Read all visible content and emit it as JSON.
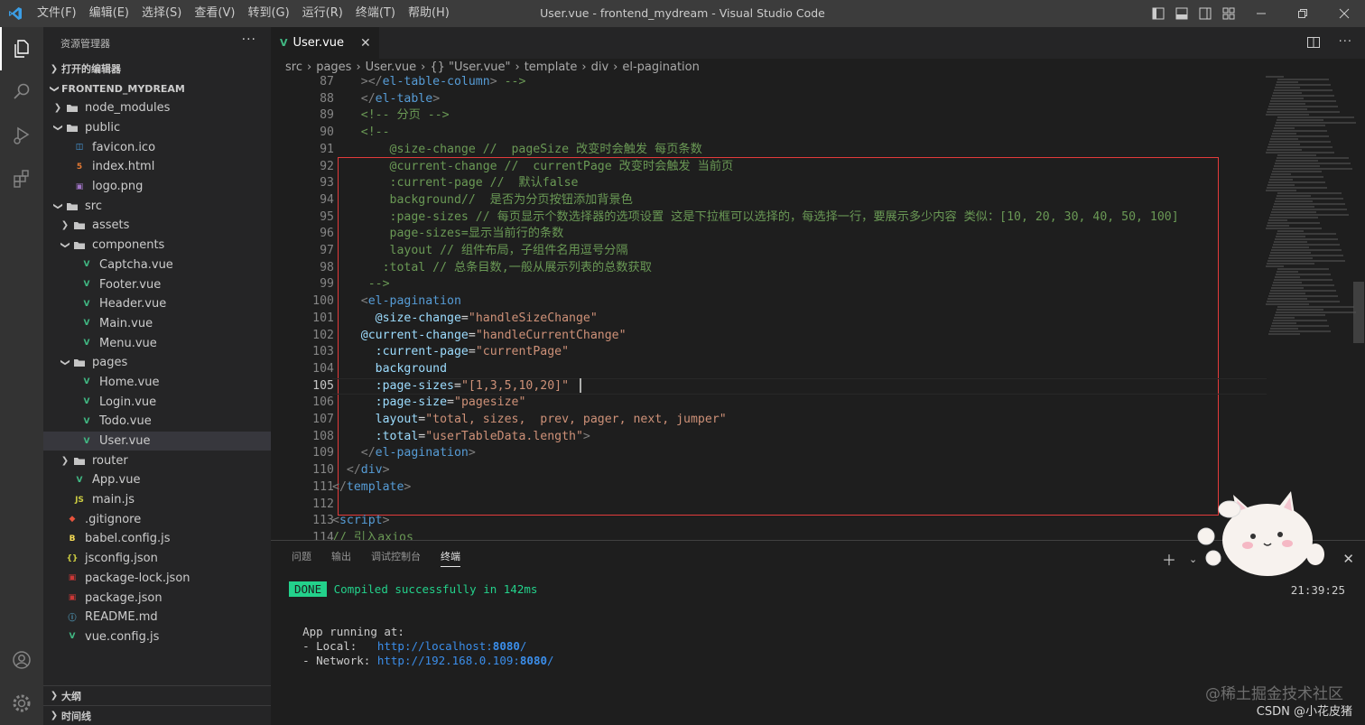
{
  "titlebar": {
    "menu": [
      "文件(F)",
      "编辑(E)",
      "选择(S)",
      "查看(V)",
      "转到(G)",
      "运行(R)",
      "终端(T)",
      "帮助(H)"
    ],
    "window_title": "User.vue - frontend_mydream - Visual Studio Code"
  },
  "activity_bar": {
    "items": [
      "explorer-icon",
      "search-icon",
      "run-debug-icon",
      "extensions-icon"
    ],
    "bottom": [
      "account-icon",
      "settings-gear-icon"
    ]
  },
  "sidebar": {
    "title": "资源管理器",
    "open_editors": "打开的编辑器",
    "project": "FRONTEND_MYDREAM",
    "tree": [
      {
        "label": "node_modules",
        "depth": 1,
        "type": "folder",
        "expanded": false
      },
      {
        "label": "public",
        "depth": 1,
        "type": "folder",
        "expanded": true
      },
      {
        "label": "favicon.ico",
        "depth": 2,
        "type": "ico"
      },
      {
        "label": "index.html",
        "depth": 2,
        "type": "html"
      },
      {
        "label": "logo.png",
        "depth": 2,
        "type": "png"
      },
      {
        "label": "src",
        "depth": 1,
        "type": "folder",
        "expanded": true
      },
      {
        "label": "assets",
        "depth": 2,
        "type": "folder",
        "expanded": false
      },
      {
        "label": "components",
        "depth": 2,
        "type": "folder",
        "expanded": true
      },
      {
        "label": "Captcha.vue",
        "depth": 3,
        "type": "vue"
      },
      {
        "label": "Footer.vue",
        "depth": 3,
        "type": "vue"
      },
      {
        "label": "Header.vue",
        "depth": 3,
        "type": "vue"
      },
      {
        "label": "Main.vue",
        "depth": 3,
        "type": "vue"
      },
      {
        "label": "Menu.vue",
        "depth": 3,
        "type": "vue"
      },
      {
        "label": "pages",
        "depth": 2,
        "type": "folder",
        "expanded": true
      },
      {
        "label": "Home.vue",
        "depth": 3,
        "type": "vue"
      },
      {
        "label": "Login.vue",
        "depth": 3,
        "type": "vue"
      },
      {
        "label": "Todo.vue",
        "depth": 3,
        "type": "vue"
      },
      {
        "label": "User.vue",
        "depth": 3,
        "type": "vue",
        "selected": true
      },
      {
        "label": "router",
        "depth": 2,
        "type": "folder",
        "expanded": false
      },
      {
        "label": "App.vue",
        "depth": 2,
        "type": "vue"
      },
      {
        "label": "main.js",
        "depth": 2,
        "type": "js"
      },
      {
        "label": ".gitignore",
        "depth": 1,
        "type": "git"
      },
      {
        "label": "babel.config.js",
        "depth": 1,
        "type": "babel"
      },
      {
        "label": "jsconfig.json",
        "depth": 1,
        "type": "jsconfig"
      },
      {
        "label": "package-lock.json",
        "depth": 1,
        "type": "npm"
      },
      {
        "label": "package.json",
        "depth": 1,
        "type": "npm"
      },
      {
        "label": "README.md",
        "depth": 1,
        "type": "md"
      },
      {
        "label": "vue.config.js",
        "depth": 1,
        "type": "vue"
      }
    ],
    "outline": "大纲",
    "timeline": "时间线"
  },
  "editor": {
    "tab_label": "User.vue",
    "breadcrumb": [
      "src",
      "pages",
      "User.vue",
      "{} \"User.vue\"",
      "template",
      "div",
      "el-pagination"
    ],
    "current_line": 105,
    "lines": [
      {
        "n": 87,
        "seg": [
          [
            "tx",
            "    "
          ],
          [
            "br",
            "></"
          ],
          [
            "tg",
            "el-table-column"
          ],
          [
            "br",
            "> "
          ],
          [
            "cm",
            "-->"
          ]
        ]
      },
      {
        "n": 88,
        "seg": [
          [
            "tx",
            "    "
          ],
          [
            "br",
            "</"
          ],
          [
            "tg",
            "el-table"
          ],
          [
            "br",
            ">"
          ]
        ]
      },
      {
        "n": 89,
        "seg": [
          [
            "tx",
            "    "
          ],
          [
            "cm",
            "<!-- 分页 -->"
          ]
        ]
      },
      {
        "n": 90,
        "seg": [
          [
            "tx",
            "    "
          ],
          [
            "cm",
            "<!--"
          ]
        ]
      },
      {
        "n": 91,
        "seg": [
          [
            "cm",
            "        @size-change //  pageSize 改变时会触发 每页条数"
          ]
        ]
      },
      {
        "n": 92,
        "seg": [
          [
            "cm",
            "        @current-change //  currentPage 改变时会触发 当前页"
          ]
        ]
      },
      {
        "n": 93,
        "seg": [
          [
            "cm",
            "        :current-page //  默认false"
          ]
        ]
      },
      {
        "n": 94,
        "seg": [
          [
            "cm",
            "        background//  是否为分页按钮添加背景色"
          ]
        ]
      },
      {
        "n": 95,
        "seg": [
          [
            "cm",
            "        :page-sizes // 每页显示个数选择器的选项设置 这是下拉框可以选择的，每选择一行，要展示多少内容 类似：[10, 20, 30, 40, 50, 100]"
          ]
        ]
      },
      {
        "n": 96,
        "seg": [
          [
            "cm",
            "        page-sizes=显示当前行的条数"
          ]
        ]
      },
      {
        "n": 97,
        "seg": [
          [
            "cm",
            "        layout // 组件布局，子组件名用逗号分隔"
          ]
        ]
      },
      {
        "n": 98,
        "seg": [
          [
            "cm",
            "       :total // 总条目数,一般从展示列表的总数获取"
          ]
        ]
      },
      {
        "n": 99,
        "seg": [
          [
            "cm",
            "     -->"
          ]
        ]
      },
      {
        "n": 100,
        "seg": [
          [
            "tx",
            "    "
          ],
          [
            "br",
            "<"
          ],
          [
            "tg",
            "el-pagination"
          ]
        ]
      },
      {
        "n": 101,
        "seg": [
          [
            "tx",
            "      "
          ],
          [
            "at",
            "@size-change"
          ],
          [
            "tx",
            "="
          ],
          [
            "st",
            "\"handleSizeChange\""
          ]
        ]
      },
      {
        "n": 102,
        "seg": [
          [
            "tx",
            "    "
          ],
          [
            "at",
            "@current-change"
          ],
          [
            "tx",
            "="
          ],
          [
            "st",
            "\"handleCurrentChange\""
          ]
        ]
      },
      {
        "n": 103,
        "seg": [
          [
            "tx",
            "      "
          ],
          [
            "at",
            ":current-page"
          ],
          [
            "tx",
            "="
          ],
          [
            "st",
            "\"currentPage\""
          ]
        ]
      },
      {
        "n": 104,
        "seg": [
          [
            "tx",
            "      "
          ],
          [
            "at",
            "background"
          ]
        ]
      },
      {
        "n": 105,
        "seg": [
          [
            "tx",
            "      "
          ],
          [
            "at",
            ":page-sizes"
          ],
          [
            "tx",
            "="
          ],
          [
            "st",
            "\"[1,3,5,10,20]\""
          ]
        ]
      },
      {
        "n": 106,
        "seg": [
          [
            "tx",
            "      "
          ],
          [
            "at",
            ":page-size"
          ],
          [
            "tx",
            "="
          ],
          [
            "st",
            "\"pagesize\""
          ]
        ]
      },
      {
        "n": 107,
        "seg": [
          [
            "tx",
            "      "
          ],
          [
            "at",
            "layout"
          ],
          [
            "tx",
            "="
          ],
          [
            "st",
            "\"total, sizes,  prev, pager, next, jumper\""
          ]
        ]
      },
      {
        "n": 108,
        "seg": [
          [
            "tx",
            "      "
          ],
          [
            "at",
            ":total"
          ],
          [
            "tx",
            "="
          ],
          [
            "st",
            "\"userTableData.length\""
          ],
          [
            "br",
            ">"
          ]
        ]
      },
      {
        "n": 109,
        "seg": [
          [
            "tx",
            "    "
          ],
          [
            "br",
            "</"
          ],
          [
            "tg",
            "el-pagination"
          ],
          [
            "br",
            ">"
          ]
        ]
      },
      {
        "n": 110,
        "seg": [
          [
            "tx",
            "  "
          ],
          [
            "br",
            "</"
          ],
          [
            "tg",
            "div"
          ],
          [
            "br",
            ">"
          ]
        ]
      },
      {
        "n": 111,
        "seg": [
          [
            "br",
            "</"
          ],
          [
            "tg",
            "template"
          ],
          [
            "br",
            ">"
          ]
        ]
      },
      {
        "n": 112,
        "seg": []
      },
      {
        "n": 113,
        "seg": [
          [
            "br",
            "<"
          ],
          [
            "tg",
            "script"
          ],
          [
            "br",
            ">"
          ]
        ]
      },
      {
        "n": 114,
        "seg": [
          [
            "cm",
            "// 引入axios"
          ]
        ]
      }
    ]
  },
  "panel": {
    "tabs": [
      "问题",
      "输出",
      "调试控制台",
      "终端"
    ],
    "active_tab": "终端",
    "terminal": {
      "badge": "DONE",
      "compiled": "Compiled successfully in 142ms",
      "time": "21:39:25",
      "app_running": "App running at:",
      "local_label": "- Local:   ",
      "local_url": "http://localhost:",
      "local_port": "8080",
      "network_label": "- Network: ",
      "network_url": "http://192.168.0.109:",
      "network_port": "8080",
      "slash": "/"
    }
  },
  "watermarks": {
    "site": "@稀土掘金技术社区",
    "author": "CSDN @小花皮猪"
  },
  "colors": {
    "accent": "#007acc",
    "highlight_box": "#e33b3b",
    "terminal_green": "#23d18b",
    "link_blue": "#3b8eea"
  }
}
